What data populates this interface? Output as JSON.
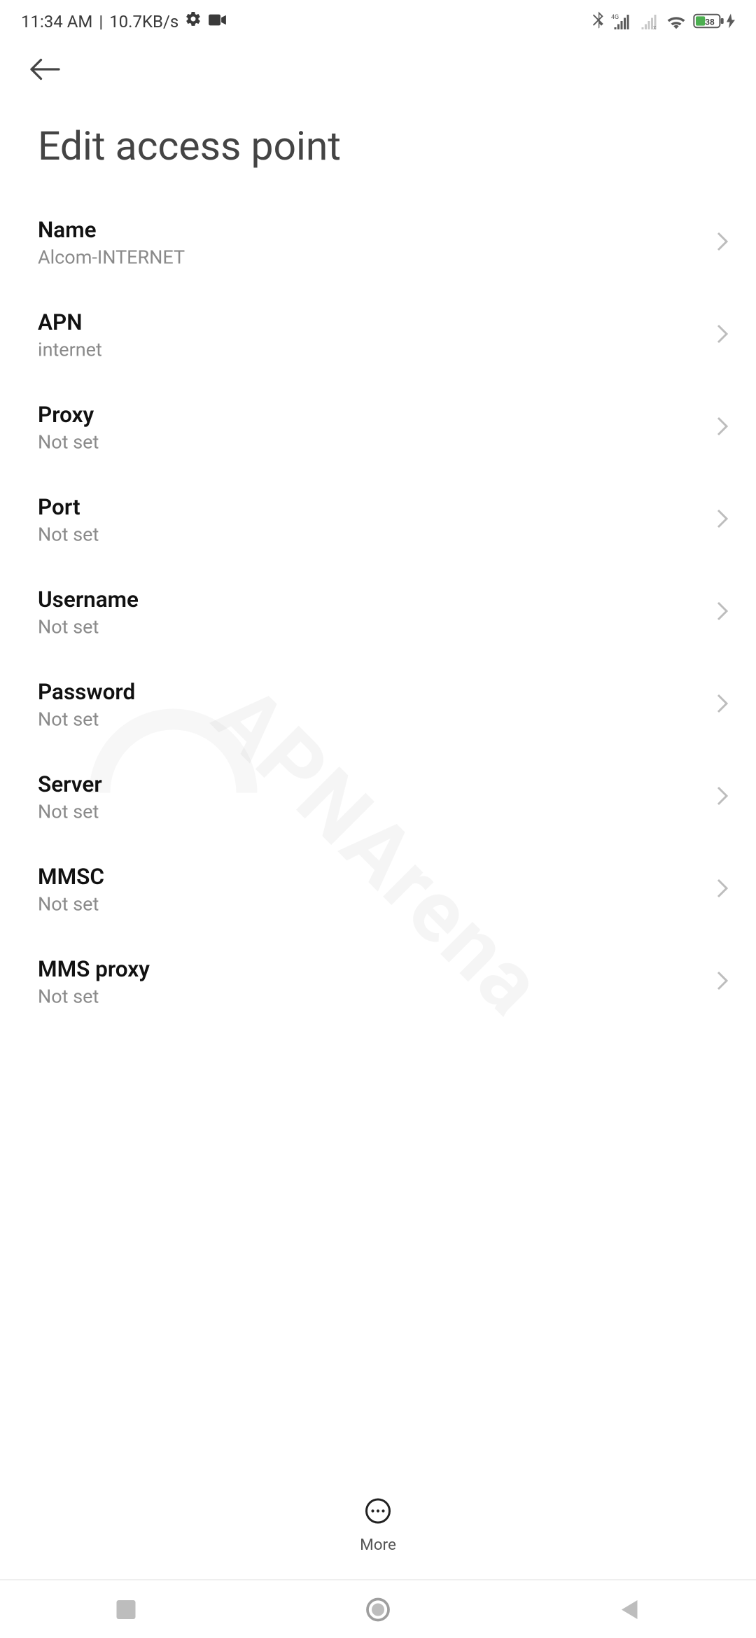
{
  "status": {
    "time": "11:34 AM",
    "separator": "|",
    "speed": "10.7KB/s",
    "battery_percent": "38"
  },
  "header": {
    "title": "Edit access point"
  },
  "rows": [
    {
      "label": "Name",
      "value": "Alcom-INTERNET"
    },
    {
      "label": "APN",
      "value": "internet"
    },
    {
      "label": "Proxy",
      "value": "Not set"
    },
    {
      "label": "Port",
      "value": "Not set"
    },
    {
      "label": "Username",
      "value": "Not set"
    },
    {
      "label": "Password",
      "value": "Not set"
    },
    {
      "label": "Server",
      "value": "Not set"
    },
    {
      "label": "MMSC",
      "value": "Not set"
    },
    {
      "label": "MMS proxy",
      "value": "Not set"
    }
  ],
  "bottom": {
    "more_label": "More"
  },
  "watermark": "APNArena"
}
